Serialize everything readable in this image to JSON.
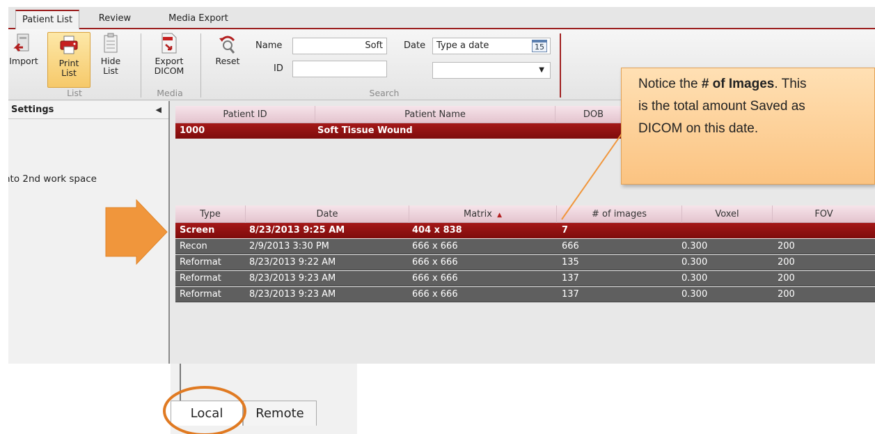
{
  "tabs": [
    {
      "label": "Patient List",
      "active": true
    },
    {
      "label": "Review",
      "active": false
    },
    {
      "label": "Media Export",
      "active": false
    }
  ],
  "ribbon": {
    "import_label": "Import",
    "print_list_label": "Print List",
    "hide_list_label": "Hide List",
    "export_dicom_label": "Export DICOM",
    "reset_label": "Reset",
    "group_list": "List",
    "group_media": "Media",
    "group_search": "Search",
    "name_label": "Name",
    "name_value": "Soft",
    "id_label": "ID",
    "id_value": "",
    "date_label": "Date",
    "date_placeholder": "Type a date",
    "calendar_day": "15",
    "date_dropdown_value": ""
  },
  "sidebar": {
    "title": "Settings",
    "item_text": "nto 2nd work space"
  },
  "patients": {
    "columns": [
      "Patient ID",
      "Patient Name",
      "DOB"
    ],
    "rows": [
      {
        "id": "1000",
        "name": "Soft Tissue Wound",
        "dob": ""
      }
    ]
  },
  "series": {
    "columns": [
      "Type",
      "Date",
      "Matrix",
      "# of images",
      "Voxel",
      "FOV"
    ],
    "rows": [
      {
        "type": "Screen",
        "date": "8/23/2013 9:25 AM",
        "matrix": "404 x 838",
        "images": "7",
        "voxel": "",
        "fov": "",
        "selected": true
      },
      {
        "type": "Recon",
        "date": "2/9/2013 3:30 PM",
        "matrix": "666 x 666",
        "images": "666",
        "voxel": "0.300",
        "fov": "200",
        "selected": false
      },
      {
        "type": "Reformat",
        "date": "8/23/2013 9:22 AM",
        "matrix": "666 x 666",
        "images": "135",
        "voxel": "0.300",
        "fov": "200",
        "selected": false
      },
      {
        "type": "Reformat",
        "date": "8/23/2013 9:23 AM",
        "matrix": "666 x 666",
        "images": "137",
        "voxel": "0.300",
        "fov": "200",
        "selected": false
      },
      {
        "type": "Reformat",
        "date": "8/23/2013 9:23 AM",
        "matrix": "666 x 666",
        "images": "137",
        "voxel": "0.300",
        "fov": "200",
        "selected": false
      }
    ]
  },
  "bottom_tabs": {
    "local": "Local",
    "remote": "Remote"
  },
  "callout": {
    "line1_pre": "Notice the ",
    "line1_bold": "# of Images",
    "line1_post": ".  This",
    "line2": "is the total amount Saved as",
    "line3": "DICOM on this date."
  },
  "colors": {
    "accent_red": "#9b1c1c",
    "selected_row": "#a41818",
    "row_grey": "#5f5f5f",
    "annotation_orange": "#f0963c"
  }
}
